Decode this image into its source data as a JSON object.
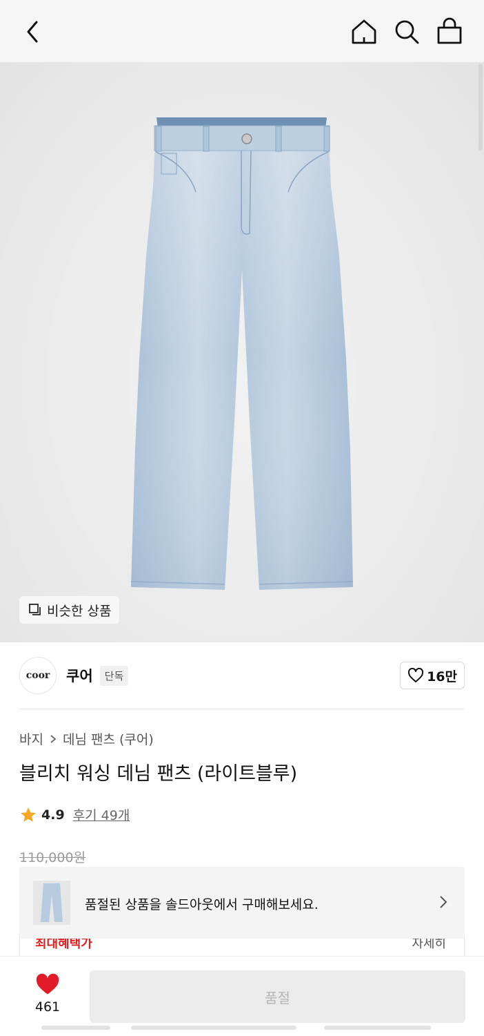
{
  "header": {
    "back_icon": "chevron-left-icon",
    "home_icon": "home-icon",
    "search_icon": "search-icon",
    "cart_icon": "shopping-bag-icon"
  },
  "hero": {
    "similar_label": "비슷한 상품",
    "similar_icon": "copy-squares-icon"
  },
  "brand": {
    "logo_text": "coor",
    "name": "쿠어",
    "badge": "단독",
    "like_count": "16만"
  },
  "breadcrumb": {
    "items": [
      "바지",
      "데님 팬츠 (쿠어)"
    ]
  },
  "product": {
    "title": "블리치 워싱 데님 팬츠 (라이트블루)",
    "rating": "4.9",
    "reviews": "후기 49개",
    "original_price": "110,000원"
  },
  "benefit": {
    "label": "최대혜택가",
    "detail": "자세히"
  },
  "soldout_banner": {
    "message": "품절된 상품을 솔드아웃에서 구매해보세요."
  },
  "bottom_bar": {
    "like_count": "461",
    "buy_label": "품절"
  },
  "colors": {
    "accent_red": "#e02020",
    "star": "#f5a623"
  }
}
